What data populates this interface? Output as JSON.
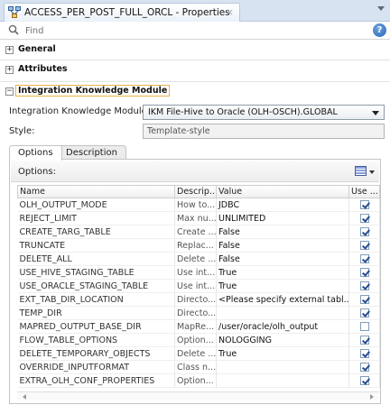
{
  "window": {
    "tab_title": "ACCESS_PER_POST_FULL_ORCL - Properties",
    "close_glyph": "×"
  },
  "find": {
    "placeholder": "Find",
    "help_glyph": "?"
  },
  "sections": {
    "general": "General",
    "attributes": "Attributes",
    "ikm": "Integration Knowledge Module",
    "collapsed_glyph": "+",
    "expanded_glyph": "−"
  },
  "ikm": {
    "label": "Integration Knowledge Module:",
    "selected": "IKM File-Hive to Oracle (OLH-OSCH).GLOBAL",
    "style_label": "Style:",
    "style_value": "Template-style"
  },
  "tabs": {
    "options": "Options",
    "description": "Description"
  },
  "options": {
    "title": "Options:",
    "columns": {
      "name": "Name",
      "desc": "Descrip...",
      "value": "Value",
      "use": "Use ..."
    },
    "rows": [
      {
        "name": "OLH_OUTPUT_MODE",
        "desc": "How to...",
        "value": "JDBC",
        "use": true
      },
      {
        "name": "REJECT_LIMIT",
        "desc": "Max nu...",
        "value": "UNLIMITED",
        "use": true
      },
      {
        "name": "CREATE_TARG_TABLE",
        "desc": "Create ...",
        "value": "False",
        "use": true
      },
      {
        "name": "TRUNCATE",
        "desc": "Replac...",
        "value": "False",
        "use": true
      },
      {
        "name": "DELETE_ALL",
        "desc": "Delete ...",
        "value": "False",
        "use": true
      },
      {
        "name": "USE_HIVE_STAGING_TABLE",
        "desc": "Use int...",
        "value": "True",
        "use": true
      },
      {
        "name": "USE_ORACLE_STAGING_TABLE",
        "desc": "Use int...",
        "value": "True",
        "use": true
      },
      {
        "name": "EXT_TAB_DIR_LOCATION",
        "desc": "Directo...",
        "value": "<Please specify external tabl...",
        "use": true
      },
      {
        "name": "TEMP_DIR",
        "desc": "Directo...",
        "value": "",
        "use": true
      },
      {
        "name": "MAPRED_OUTPUT_BASE_DIR",
        "desc": "MapRe...",
        "value": "/user/oracle/olh_output",
        "use": false
      },
      {
        "name": "FLOW_TABLE_OPTIONS",
        "desc": "Option...",
        "value": "NOLOGGING",
        "use": true
      },
      {
        "name": "DELETE_TEMPORARY_OBJECTS",
        "desc": "Delete ...",
        "value": "True",
        "use": true
      },
      {
        "name": "OVERRIDE_INPUTFORMAT",
        "desc": "Class n...",
        "value": "",
        "use": true
      },
      {
        "name": "EXTRA_OLH_CONF_PROPERTIES",
        "desc": "Option...",
        "value": "",
        "use": true
      }
    ]
  }
}
